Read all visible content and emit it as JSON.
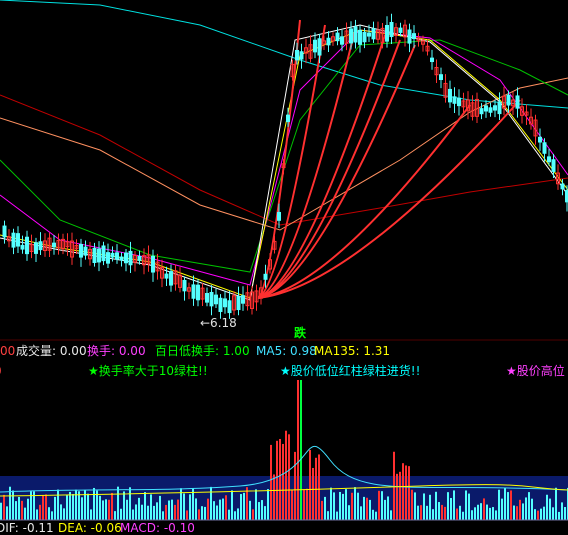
{
  "main_panel": {
    "low_label": "←6.18",
    "signal_label": "跌"
  },
  "volume_header": {
    "prefix": "00",
    "volume": "成交量: 0.00",
    "turnover": "换手: 0.00",
    "low_turnover": "百日低换手: 1.00",
    "ma5": "MA5: 0.98",
    "ma135": "MA135: 1.31"
  },
  "signals": {
    "left_mark": "0",
    "turnover_gt10": "★换手率大于10绿柱!!",
    "low_price_red_green": "★股价低位红柱绿柱进货!!",
    "high_price": "★股价高位"
  },
  "macd_header": {
    "dif": "DIF: -0.11",
    "dea": "DEA: -0.06",
    "macd": "MACD: -0.10"
  },
  "colors": {
    "background": "#000000",
    "up_candle": "#ff3030",
    "down_candle": "#54ffff",
    "ma_white": "#ffffff",
    "ma_yellow": "#ffff00",
    "ma_magenta": "#ff00ff",
    "ma_green": "#00c000",
    "ma_cyan": "#00e0e0",
    "ma_darkred": "#c00000",
    "ma_salmon": "#ff9060",
    "panel_blue": "#0a1a6a"
  }
}
